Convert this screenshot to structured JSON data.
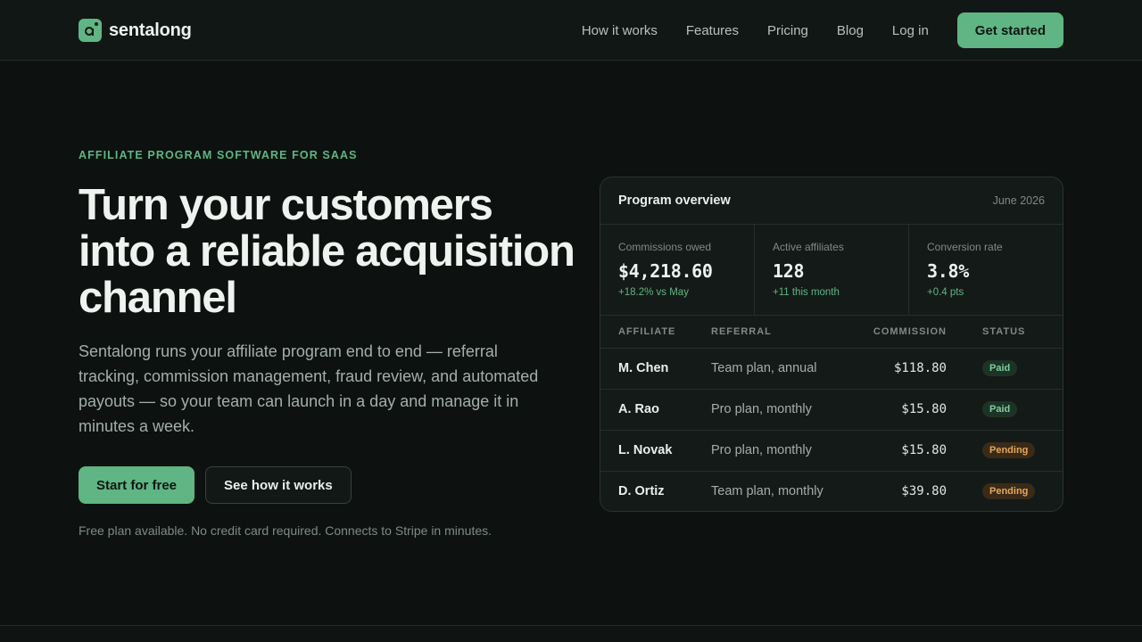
{
  "brand": {
    "name": "sentalong"
  },
  "nav": {
    "links": [
      "How it works",
      "Features",
      "Pricing",
      "Blog",
      "Log in"
    ],
    "cta": "Get started"
  },
  "hero": {
    "eyebrow": "AFFILIATE PROGRAM SOFTWARE FOR SAAS",
    "headline": "Turn your customers into a reliable acquisition channel",
    "subtitle": "Sentalong runs your affiliate program end to end — referral tracking, commission management, fraud review, and automated payouts — so your team can launch in a day and manage it in minutes a week.",
    "primary_cta": "Start for free",
    "secondary_cta": "See how it works",
    "fineprint": "Free plan available. No credit card required. Connects to Stripe in minutes."
  },
  "card": {
    "title": "Program overview",
    "date": "June 2026",
    "stats": [
      {
        "label": "Commissions owed",
        "value": "$4,218.60",
        "delta": "+18.2% vs May"
      },
      {
        "label": "Active affiliates",
        "value": "128",
        "delta": "+11 this month"
      },
      {
        "label": "Conversion rate",
        "value": "3.8%",
        "delta": "+0.4 pts"
      }
    ],
    "columns": [
      "AFFILIATE",
      "REFERRAL",
      "COMMISSION",
      "STATUS"
    ],
    "rows": [
      {
        "affiliate": "M. Chen",
        "referral": "Team plan, annual",
        "commission": "$118.80",
        "status": "Paid"
      },
      {
        "affiliate": "A. Rao",
        "referral": "Pro plan, monthly",
        "commission": "$15.80",
        "status": "Paid"
      },
      {
        "affiliate": "L. Novak",
        "referral": "Pro plan, monthly",
        "commission": "$15.80",
        "status": "Pending"
      },
      {
        "affiliate": "D. Ortiz",
        "referral": "Team plan, monthly",
        "commission": "$39.80",
        "status": "Pending"
      }
    ]
  },
  "colors": {
    "accent": "#5fb583",
    "background": "#0d1210",
    "pending": "#e6a85a"
  },
  "icons": {
    "logo": "logo-icon"
  }
}
